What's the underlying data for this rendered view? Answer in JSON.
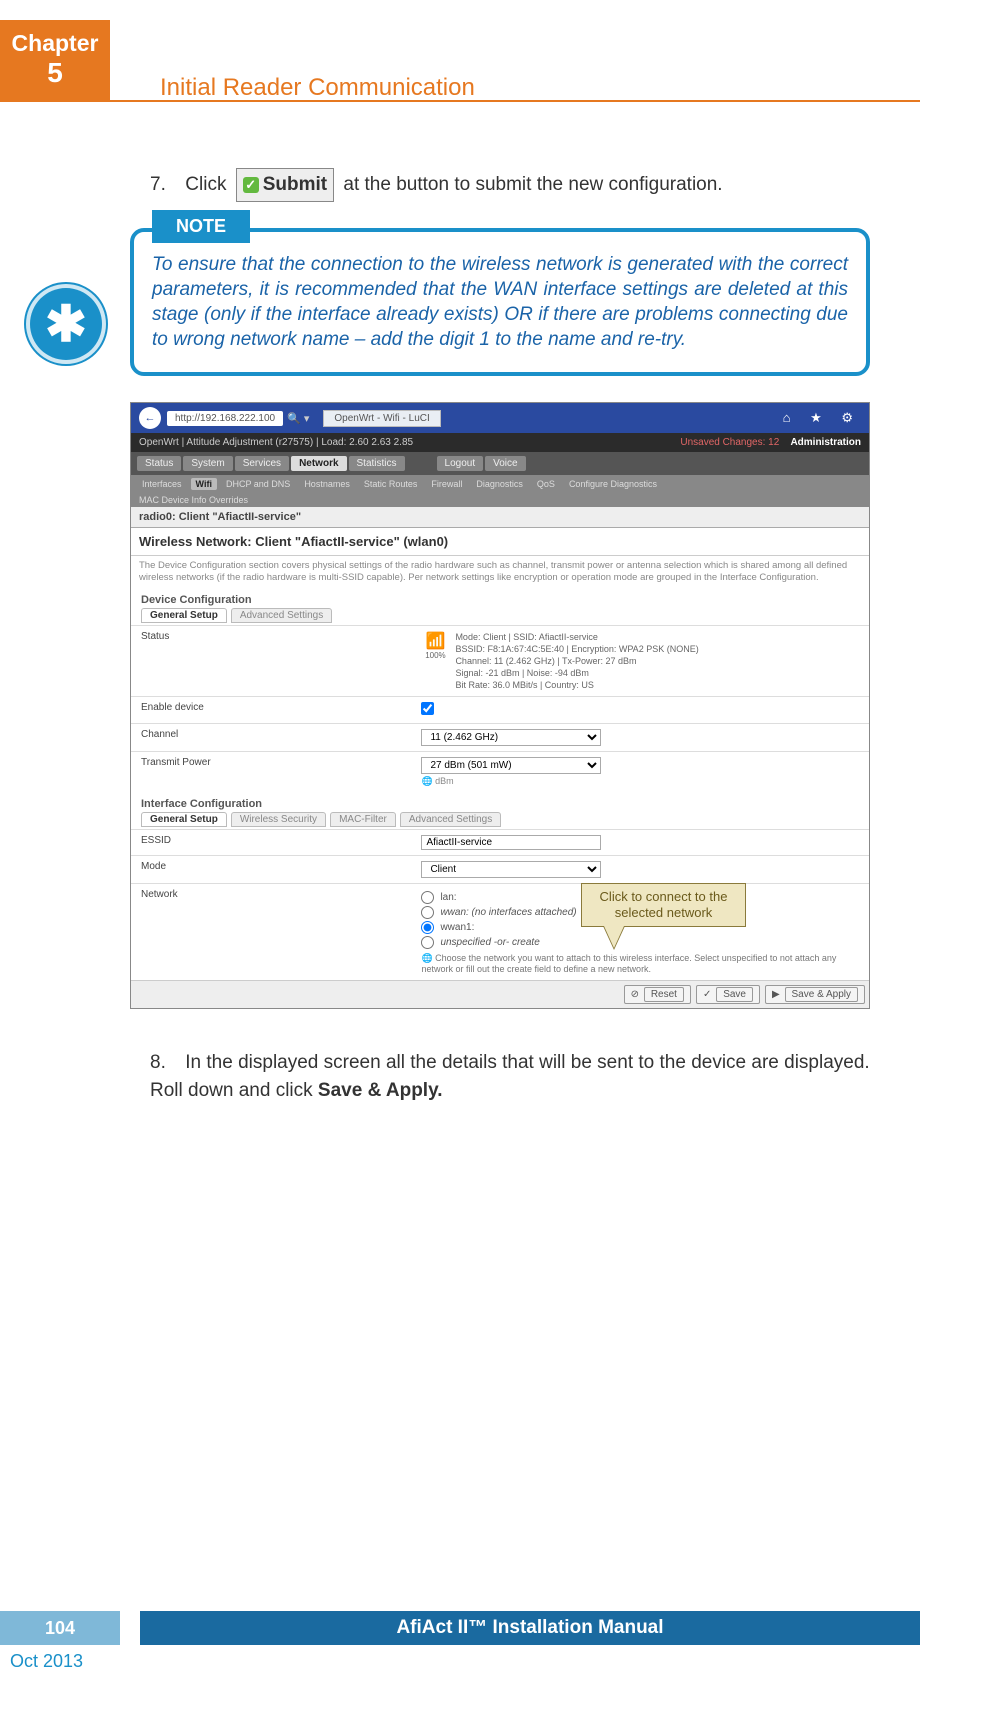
{
  "chapter": {
    "label": "Chapter",
    "number": "5"
  },
  "section_title": "Initial Reader Communication",
  "step7": {
    "num": "7.",
    "pre": "Click",
    "submit_label": "Submit",
    "post": "at the button to submit the new configuration."
  },
  "note": {
    "tab": "NOTE",
    "text": "To ensure that the connection to the wireless network is generated with the correct parameters, it is recommended that the WAN interface settings are deleted at this stage (only if the interface already exists) OR if there are problems connecting due to wrong network name – add the digit 1 to the name and re-try."
  },
  "callout": "Click to connect to the selected network",
  "browser": {
    "url": "http://192.168.222.100",
    "tab": "OpenWrt - Wifi - LuCI",
    "win_icons": "⌂ ★ ⚙",
    "bread_left": "OpenWrt | Attitude Adjustment (r27575) | Load: 2.60 2.63 2.85",
    "unsaved": "Unsaved Changes: 12",
    "admin": "Administration",
    "tabs": [
      "Status",
      "System",
      "Services",
      "Network",
      "Statistics",
      "Logout",
      "Voice"
    ],
    "tabs_active": "Network",
    "subtabs": [
      "Interfaces",
      "Wifi",
      "DHCP and DNS",
      "Hostnames",
      "Static Routes",
      "Firewall",
      "Diagnostics",
      "QoS",
      "Configure Diagnostics"
    ],
    "subtabs_active": "Wifi",
    "mac_line": "MAC Device Info Overrides",
    "radio_head": "radio0: Client \"AfiactII-service\"",
    "wnet": "Wireless Network: Client \"AfiactII-service\" (wlan0)",
    "desc": "The Device Configuration section covers physical settings of the radio hardware such as channel, transmit power or antenna selection which is shared among all defined wireless networks (if the radio hardware is multi-SSID capable). Per network settings like encryption or operation mode are grouped in the Interface Configuration.",
    "dev_conf": "Device Configuration",
    "dev_tabs": [
      "General Setup",
      "Advanced Settings"
    ],
    "status_label": "Status",
    "status_pct": "100%",
    "status_text": "Mode: Client | SSID: AfiactII-service\nBSSID: F8:1A:67:4C:5E:40 | Encryption: WPA2 PSK (NONE)\nChannel: 11 (2.462 GHz) | Tx-Power: 27 dBm\nSignal: -21 dBm | Noise: -94 dBm\nBit Rate: 36.0 MBit/s | Country: US",
    "enable_label": "Enable device",
    "channel_label": "Channel",
    "channel_value": "11 (2.462 GHz)",
    "tx_label": "Transmit Power",
    "tx_value": "27 dBm (501 mW)",
    "tx_sub": "dBm",
    "iface_conf": "Interface Configuration",
    "iface_tabs": [
      "General Setup",
      "Wireless Security",
      "MAC-Filter",
      "Advanced Settings"
    ],
    "essid_label": "ESSID",
    "essid_value": "AfiactII-service",
    "mode_label": "Mode",
    "mode_value": "Client",
    "net_label": "Network",
    "net_options": [
      "lan:",
      "wwan: (no interfaces attached)",
      "wwan1:",
      "unspecified -or- create"
    ],
    "net_checked_index": 2,
    "net_hint": "Choose the network you want to attach to this wireless interface. Select unspecified to not attach any network or fill out the create field to define a new network.",
    "buttons": [
      "Reset",
      "Save",
      "Save & Apply"
    ]
  },
  "step8": {
    "num": "8.",
    "text_a": "In the displayed screen all the details that will be sent to the device are displayed. Roll down and click ",
    "text_b": "Save & Apply."
  },
  "footer": {
    "page": "104",
    "title": "AfiAct II™ Installation Manual",
    "date": "Oct 2013"
  }
}
